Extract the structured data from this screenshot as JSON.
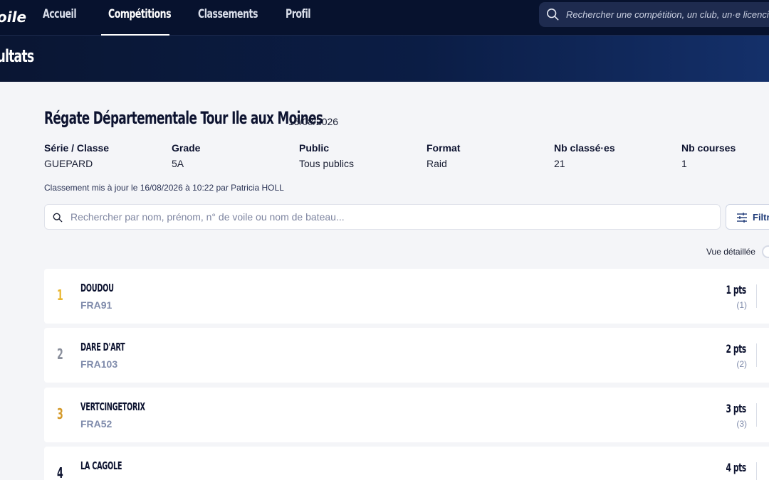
{
  "header": {
    "logo": "oile",
    "nav": [
      {
        "label": "Accueil",
        "active": false
      },
      {
        "label": "Compétitions",
        "active": true
      },
      {
        "label": "Classements",
        "active": false
      },
      {
        "label": "Profil",
        "active": false
      }
    ],
    "search_placeholder": "Rechercher une compétition, un club, un·e licencié·e..."
  },
  "banner": {
    "title": "sultats"
  },
  "competition": {
    "title": "Régate Départementale Tour Ile aux Moines",
    "date": "15/08/2026",
    "info": [
      {
        "label": "Série / Classe",
        "value": "GUEPARD"
      },
      {
        "label": "Grade",
        "value": "5A"
      },
      {
        "label": "Public",
        "value": "Tous publics"
      },
      {
        "label": "Format",
        "value": "Raid"
      },
      {
        "label": "Nb classé·es",
        "value": "21"
      },
      {
        "label": "Nb courses",
        "value": "1"
      }
    ],
    "updated": "Classement mis à jour le 16/08/2026 à 10:22 par Patricia HOLL"
  },
  "results_search": {
    "placeholder": "Rechercher par nom, prénom, n° de voile ou nom de bateau..."
  },
  "filter": {
    "label": "Filtr"
  },
  "detail_view": {
    "label": "Vue détaillée",
    "on": false
  },
  "rank_colors": {
    "gold": "#e9b62f",
    "silver": "#8a8f9c",
    "bronze": "#d49a2a",
    "default": "#0d1330"
  },
  "results": [
    {
      "rank": "1",
      "boat": "DOUDOU",
      "sail": "FRA91",
      "points": "1 pts",
      "sub": "(1)"
    },
    {
      "rank": "2",
      "boat": "DARE D'ART",
      "sail": "FRA103",
      "points": "2 pts",
      "sub": "(2)"
    },
    {
      "rank": "3",
      "boat": "VERTCINGETORIX",
      "sail": "FRA52",
      "points": "3 pts",
      "sub": "(3)"
    },
    {
      "rank": "4",
      "boat": "LA CAGOLE",
      "sail": "",
      "points": "4 pts",
      "sub": ""
    }
  ]
}
